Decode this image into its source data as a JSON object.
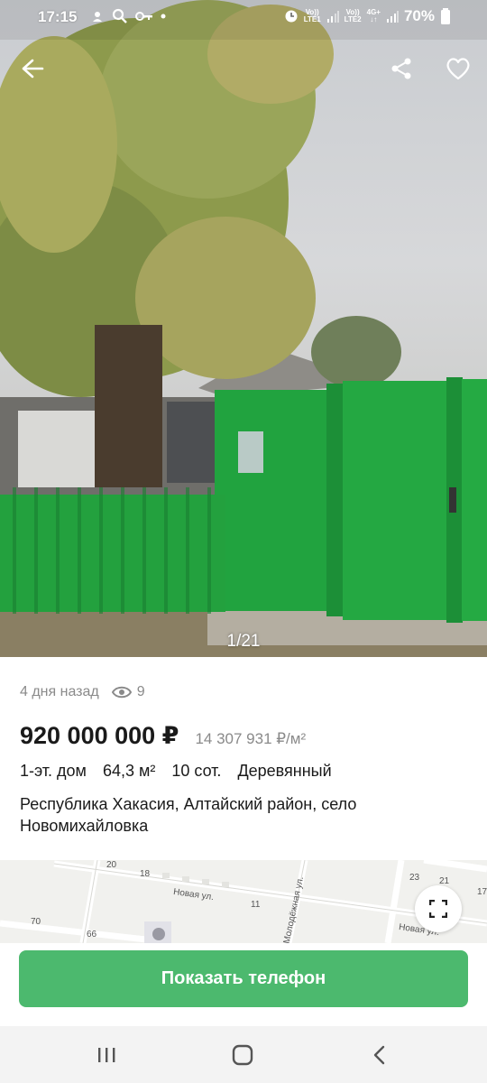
{
  "status_bar": {
    "time": "17:15",
    "sim1": "LTE1",
    "sim2": "LTE2",
    "volte1": "Vo))",
    "volte2": "Vo))",
    "net": "4G+",
    "battery": "70%"
  },
  "photo": {
    "counter": "1/21",
    "description_icons": [
      "back-arrow-icon",
      "share-icon",
      "heart-icon"
    ]
  },
  "listing": {
    "posted": "4 дня назад",
    "views": "9",
    "price": "920 000 000 ₽",
    "price_per_m2": "14 307 931 ₽/м²",
    "params": [
      "1-эт. дом",
      "64,3 м²",
      "10 сот.",
      "Деревянный"
    ],
    "address": "Республика Хакасия, Алтайский район, село Новомихайловка"
  },
  "map": {
    "labels": {
      "n20": "20",
      "n18": "18",
      "n11": "11",
      "n23": "23",
      "n21": "21",
      "n17": "17",
      "n70": "70",
      "n66": "66",
      "street1": "Новая ул.",
      "street2": "Молодёжная ул.",
      "street3": "Новая ул."
    }
  },
  "actions": {
    "show_phone": "Показать телефон"
  },
  "colors": {
    "accent": "#4cb96e",
    "fence": "#21a33f",
    "muted_text": "#8a8a8a"
  }
}
